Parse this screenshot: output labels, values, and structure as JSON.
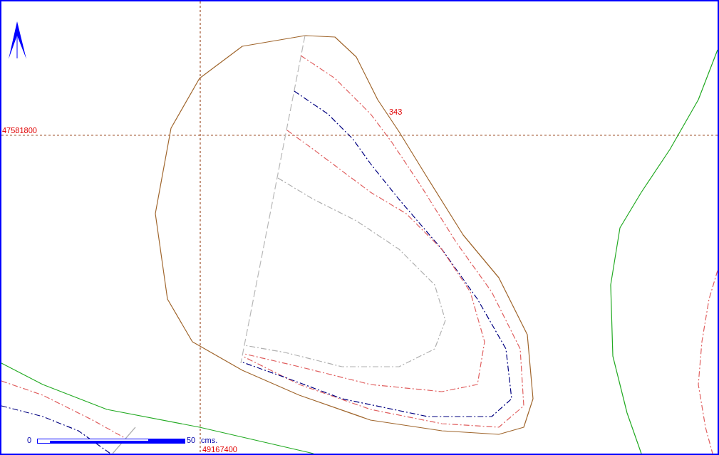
{
  "map": {
    "horizontal_grid_label": "47581800",
    "vertical_grid_label": "49167400",
    "contour_label": "343",
    "scale_bar": {
      "start": "0",
      "end": "50",
      "unit": "cms."
    }
  }
}
